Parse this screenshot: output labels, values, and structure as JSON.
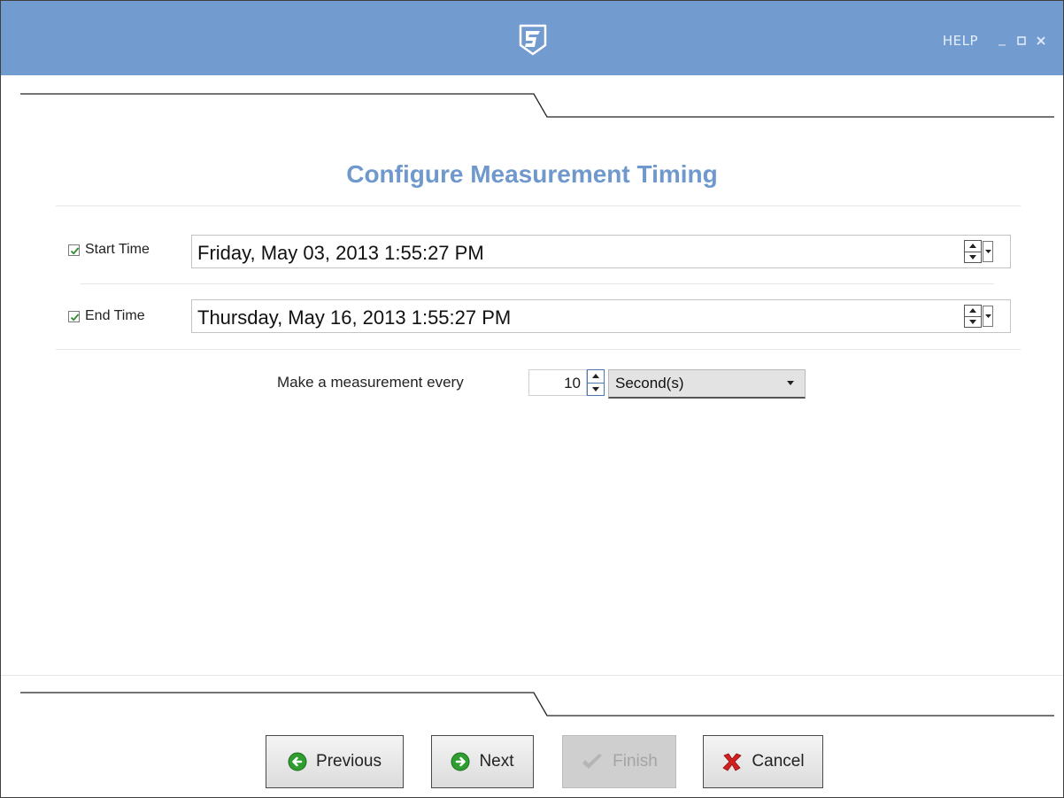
{
  "titlebar": {
    "logo": "campbell-scientific-logo-icon",
    "help_label": "HELP",
    "minimize_icon": "minimize-icon",
    "maximize_icon": "maximize-icon",
    "close_icon": "close-icon"
  },
  "page": {
    "heading": "Configure Measurement Timing"
  },
  "start_time": {
    "label": "Start Time",
    "checked": true,
    "value": "Friday, May 03, 2013 1:55:27 PM"
  },
  "end_time": {
    "label": "End Time",
    "checked": true,
    "value": "Thursday, May 16, 2013 1:55:27 PM"
  },
  "interval": {
    "label": "Make a measurement every",
    "value": "10",
    "unit": "Second(s)"
  },
  "footer": {
    "previous_label": "Previous",
    "next_label": "Next",
    "finish_label": "Finish",
    "cancel_label": "Cancel",
    "finish_disabled": true
  },
  "colors": {
    "titlebar": "#729bd0",
    "heading": "#6f98cc",
    "check": "#2e8b2e",
    "button_green": "#2f9d2f",
    "cancel_red": "#d22020"
  }
}
